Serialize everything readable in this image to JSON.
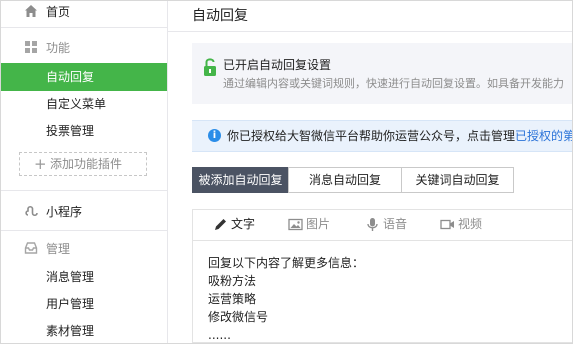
{
  "sidebar": {
    "home_label": "首页",
    "features_label": "功能",
    "items": [
      {
        "label": "自动回复"
      },
      {
        "label": "自定义菜单"
      },
      {
        "label": "投票管理"
      }
    ],
    "add_plugin_label": "添加功能插件",
    "mini_program_label": "小程序",
    "manage_label": "管理",
    "manage_items": [
      {
        "label": "消息管理"
      },
      {
        "label": "用户管理"
      },
      {
        "label": "素材管理"
      }
    ],
    "active_color": "#44b549"
  },
  "main": {
    "title": "自动回复",
    "status_title": "已开启自动回复设置",
    "status_desc": "通过编辑内容或关键词规则，快速进行自动回复设置。如具备开发能力",
    "notice_text": "你已授权给大智微信平台帮助你运营公众号，点击管理",
    "notice_link": "已授权的第三方",
    "tabs": [
      {
        "label": "被添加自动回复",
        "active": true
      },
      {
        "label": "消息自动回复"
      },
      {
        "label": "关键词自动回复"
      }
    ],
    "toolbar": {
      "text_label": "文字",
      "image_label": "图片",
      "voice_label": "语音",
      "video_label": "视频"
    },
    "content_lines": [
      "回复以下内容了解更多信息：",
      "吸粉方法",
      "运营策略",
      "修改微信号",
      "......"
    ]
  }
}
